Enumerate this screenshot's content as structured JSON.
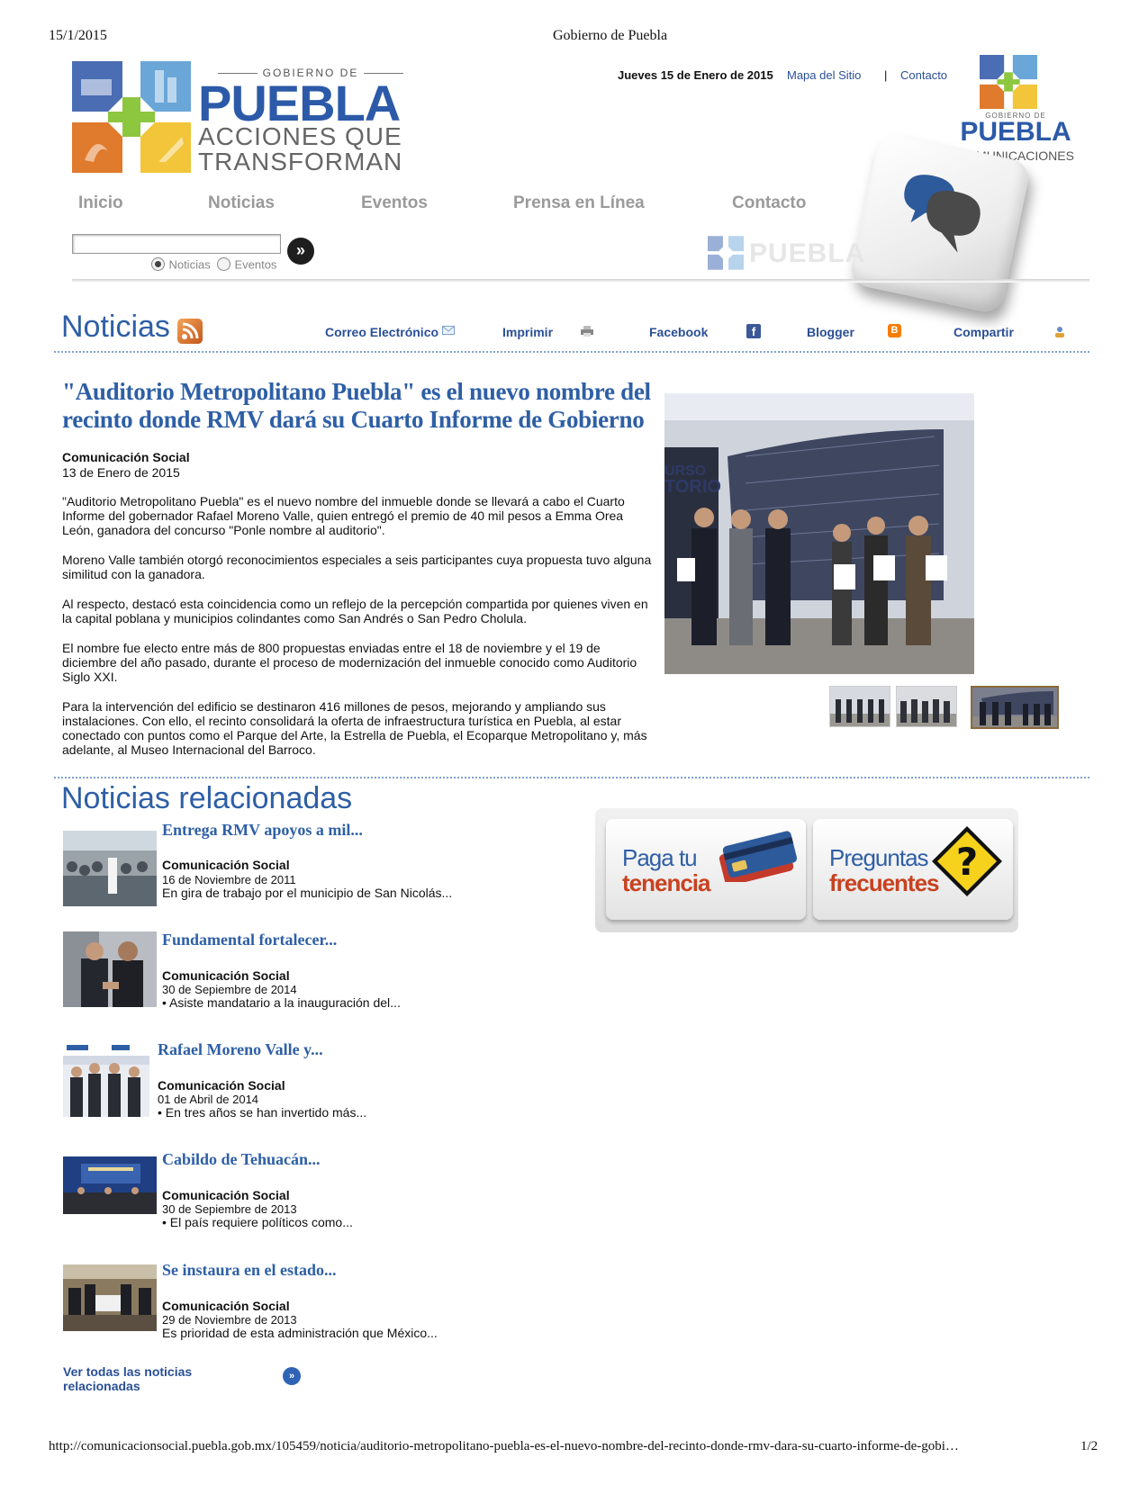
{
  "print": {
    "date": "15/1/2015",
    "title": "Gobierno de Puebla",
    "url": "http://comunicacionsocial.puebla.gob.mx/105459/noticia/auditorio-metropolitano-puebla-es-el-nuevo-nombre-del-recinto-donde-rmv-dara-su-cuarto-informe-de-gobi…",
    "page": "1/2"
  },
  "logo": {
    "gobierno_de": "GOBIERNO DE",
    "puebla": "PUEBLA",
    "tagline_1": "ACCIONES QUE",
    "tagline_2": "TRANSFORMAN"
  },
  "utility": {
    "today": "Jueves 15 de Enero de 2015",
    "mapa": "Mapa del Sitio",
    "separator": "|",
    "contacto": "Contacto"
  },
  "com_logo": {
    "gobierno_de": "GOBIERNO DE",
    "puebla": "PUEBLA",
    "comunicaciones": "COMUNICACIONES"
  },
  "nav": [
    "Inicio",
    "Noticias",
    "Eventos",
    "Prensa en Línea",
    "Contacto"
  ],
  "search": {
    "value": "",
    "options": [
      "Noticias",
      "Eventos"
    ],
    "selected": "Noticias",
    "faint_logo": "PUEBLA"
  },
  "section": {
    "title": "Noticias",
    "share": {
      "email": "Correo Electrónico",
      "print": "Imprimir",
      "facebook": "Facebook",
      "blogger": "Blogger",
      "compartir": "Compartir"
    }
  },
  "article": {
    "title": "\"Auditorio Metropolitano Puebla\" es el nuevo nombre del recinto donde RMV dará su Cuarto Informe de Gobierno",
    "author": "Comunicación Social",
    "date": "13 de Enero de 2015",
    "paragraphs": [
      "\"Auditorio Metropolitano Puebla\" es el nuevo nombre del inmueble donde se llevará a cabo el Cuarto Informe del gobernador Rafael Moreno Valle, quien entregó el premio de 40 mil pesos a Emma Orea León, ganadora del concurso \"Ponle nombre al auditorio\".",
      "Moreno Valle también otorgó reconocimientos especiales a seis participantes cuya propuesta tuvo alguna similitud con la ganadora.",
      "Al respecto, destacó esta coincidencia como un reflejo de la percepción compartida por quienes viven en la capital poblana y municipios colindantes como San Andrés o San Pedro Cholula.",
      "El nombre fue electo entre más de 800 propuestas enviadas entre el 18 de noviembre y el 19 de diciembre del año  pasado, durante el proceso de modernización del inmueble conocido como Auditorio Siglo XXI.",
      "Para la intervención del edificio se destinaron 416 millones de pesos, mejorando y ampliando sus instalaciones. Con ello, el recinto consolidará la oferta de infraestructura turística en Puebla, al estar conectado con puntos como el Parque del Arte, la Estrella de Puebla, el Ecoparque Metropolitano y, más adelante, al Museo Internacional del Barroco."
    ],
    "photo_sign": [
      "URSO",
      "TORIO"
    ]
  },
  "related": {
    "title": "Noticias relacionadas",
    "items": [
      {
        "headline": "Entrega RMV apoyos a mil...",
        "author": "Comunicación Social",
        "date": "16 de Noviembre de 2011",
        "summary": "En gira de trabajo por el municipio de San Nicolás..."
      },
      {
        "headline": "Fundamental fortalecer...",
        "author": "Comunicación Social",
        "date": "30 de Sepiembre de 2014",
        "summary": "• Asiste mandatario a la inauguración del..."
      },
      {
        "headline": "Rafael Moreno Valle y...",
        "author": "Comunicación Social",
        "date": "01 de Abril de 2014",
        "summary": "• En tres años se han invertido más..."
      },
      {
        "headline": "Cabildo de Tehuacán...",
        "author": "Comunicación Social",
        "date": "30 de Sepiembre de 2013",
        "summary": "• El país requiere políticos como..."
      },
      {
        "headline": "Se instaura en el estado...",
        "author": "Comunicación Social",
        "date": "29 de Noviembre de 2013",
        "summary": "Es prioridad de esta administración que México..."
      }
    ],
    "see_all_1": "Ver todas las noticias",
    "see_all_2": "relacionadas"
  },
  "banners": {
    "tenencia_1": "Paga tu",
    "tenencia_2": "tenencia",
    "preguntas_1": "Preguntas",
    "preguntas_2": "frecuentes"
  },
  "colors": {
    "brand_blue": "#2e5fa6",
    "link_blue": "#2a4f96",
    "orange": "#c9411f"
  }
}
